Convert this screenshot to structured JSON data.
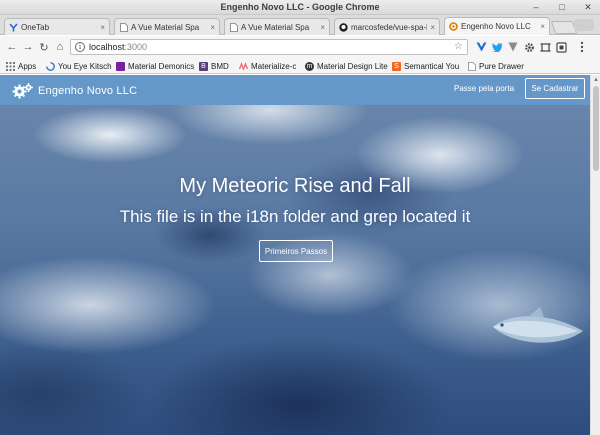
{
  "window": {
    "title": "Engenho Novo LLC - Google Chrome",
    "controls": {
      "minimize": "–",
      "maximize": "□",
      "close": "✕"
    }
  },
  "tabs": [
    {
      "label": "OneTab",
      "icon": "onetab-icon",
      "active": false
    },
    {
      "label": "A Vue Material Spa",
      "icon": "page-icon",
      "active": false
    },
    {
      "label": "A Vue Material Spa",
      "icon": "page-icon",
      "active": false
    },
    {
      "label": "marcosfede/vue-spa-b",
      "icon": "github-icon",
      "active": false
    },
    {
      "label": "Engenho Novo LLC",
      "icon": "engenho-icon",
      "active": true
    }
  ],
  "tab_close": "×",
  "toolbar": {
    "url_host": "localhost",
    "url_port": ":3000",
    "info": "i",
    "star": "☆",
    "back": "←",
    "forward": "→",
    "reload": "↻",
    "home": "⌂"
  },
  "bookmarks": [
    {
      "label": "Apps",
      "icon": "apps-grid-icon",
      "color": "#777777"
    },
    {
      "label": "You Eye Kitsch",
      "icon": "spinner-icon",
      "color": "#3b7fd4"
    },
    {
      "label": "Material Demonics",
      "icon": "material-icon",
      "color": "#7b1fa2"
    },
    {
      "label": "BMD",
      "icon": "bootstrap-icon",
      "color": "#563d7c"
    },
    {
      "label": "Materialize-c",
      "icon": "materialize-icon",
      "color": "#ee6e73"
    },
    {
      "label": "Material Design Lite",
      "icon": "mdl-icon",
      "color": "#333333"
    },
    {
      "label": "Semantical You",
      "icon": "semantic-icon",
      "color": "#f26522"
    },
    {
      "label": "Pure Drawer",
      "icon": "page-icon",
      "color": "#888888"
    }
  ],
  "app": {
    "brand": "Engenho Novo LLC",
    "nav_link": "Passe pela porta",
    "cta": "Se Cadastrar",
    "hero_title": "My Meteoric Rise and Fall",
    "hero_subtitle": "This file is in the i18n folder and grep located it",
    "hero_button": "Primeiros Passos"
  },
  "colors": {
    "appbar": "#6598c9",
    "chrome_bg": "#f5f5f5"
  }
}
